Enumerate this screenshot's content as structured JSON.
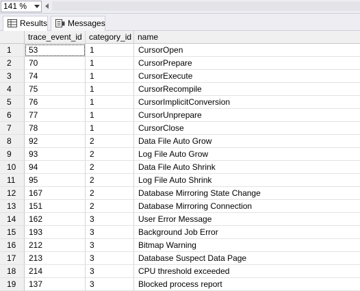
{
  "zoom": {
    "value": "141 %"
  },
  "tabs": [
    {
      "label": "Results",
      "icon": "grid-icon"
    },
    {
      "label": "Messages",
      "icon": "messages-icon"
    }
  ],
  "columns": [
    "trace_event_id",
    "category_id",
    "name"
  ],
  "rows": [
    [
      "1",
      "53",
      "1",
      "CursorOpen"
    ],
    [
      "2",
      "70",
      "1",
      "CursorPrepare"
    ],
    [
      "3",
      "74",
      "1",
      "CursorExecute"
    ],
    [
      "4",
      "75",
      "1",
      "CursorRecompile"
    ],
    [
      "5",
      "76",
      "1",
      "CursorImplicitConversion"
    ],
    [
      "6",
      "77",
      "1",
      "CursorUnprepare"
    ],
    [
      "7",
      "78",
      "1",
      "CursorClose"
    ],
    [
      "8",
      "92",
      "2",
      "Data File Auto Grow"
    ],
    [
      "9",
      "93",
      "2",
      "Log File Auto Grow"
    ],
    [
      "10",
      "94",
      "2",
      "Data File Auto Shrink"
    ],
    [
      "11",
      "95",
      "2",
      "Log File Auto Shrink"
    ],
    [
      "12",
      "167",
      "2",
      "Database Mirroring State Change"
    ],
    [
      "13",
      "151",
      "2",
      "Database Mirroring Connection"
    ],
    [
      "14",
      "162",
      "3",
      "User Error Message"
    ],
    [
      "15",
      "193",
      "3",
      "Background Job Error"
    ],
    [
      "16",
      "212",
      "3",
      "Bitmap Warning"
    ],
    [
      "17",
      "213",
      "3",
      "Database Suspect Data Page"
    ],
    [
      "18",
      "214",
      "3",
      "CPU threshold exceeded"
    ],
    [
      "19",
      "137",
      "3",
      "Blocked process report"
    ]
  ]
}
